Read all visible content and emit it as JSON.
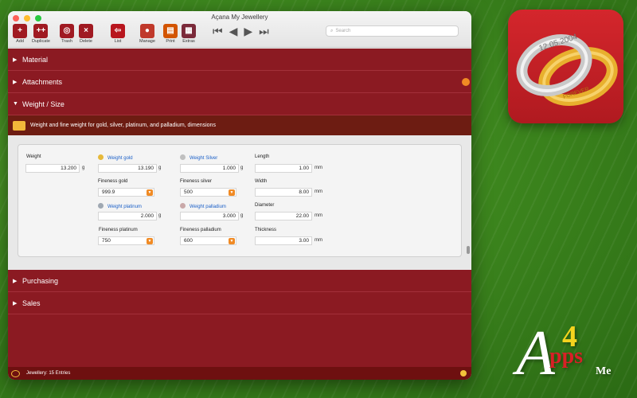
{
  "window": {
    "title": "Açana My Jewellery"
  },
  "toolbar": {
    "add": "Add",
    "duplicate": "Duplicate",
    "trash": "Trash",
    "delete": "Delete",
    "list": "List",
    "manage": "Manage",
    "print": "Print",
    "extras": "Extras"
  },
  "search": {
    "placeholder": "Search"
  },
  "sections": {
    "material": "Material",
    "attachments": "Attachments",
    "weight_size": "Weight / Size",
    "purchasing": "Purchasing",
    "sales": "Sales"
  },
  "info": "Weight and fine weight for gold, silver, platinum, and palladium, dimensions",
  "fields": {
    "weight": {
      "label": "Weight",
      "value": "13.200",
      "unit": "g"
    },
    "weight_gold": {
      "label": "Weight gold",
      "value": "13.190",
      "unit": "g"
    },
    "weight_silver": {
      "label": "Weight Silver",
      "value": "1.000",
      "unit": "g"
    },
    "length": {
      "label": "Length",
      "value": "1.00",
      "unit": "mm"
    },
    "fineness_gold": {
      "label": "Fineness gold",
      "value": "999.9"
    },
    "fineness_silver": {
      "label": "Fineness silver",
      "value": "500"
    },
    "width": {
      "label": "Width",
      "value": "8.00",
      "unit": "mm"
    },
    "weight_platinum": {
      "label": "Weight platinum",
      "value": "2.000",
      "unit": "g"
    },
    "weight_palladium": {
      "label": "Weight palladium",
      "value": "3.000",
      "unit": "g"
    },
    "diameter": {
      "label": "Diameter",
      "value": "22.00",
      "unit": "mm"
    },
    "fineness_platinum": {
      "label": "Fineness platinum",
      "value": "750"
    },
    "fineness_palladium": {
      "label": "Fineness palladium",
      "value": "600"
    },
    "thickness": {
      "label": "Thickness",
      "value": "3.00",
      "unit": "mm"
    }
  },
  "status": {
    "text": "Jewellery: 15 Entries"
  },
  "appicon": {
    "engraving1": "12.05.2004",
    "engraving2": "FOREVER"
  },
  "brand": {
    "a": "A",
    "four": "4",
    "pps": "pps",
    "me": "Me"
  },
  "colors": {
    "accent": "#8b1a22",
    "orange": "#f08a24",
    "link": "#1a5fc7"
  }
}
